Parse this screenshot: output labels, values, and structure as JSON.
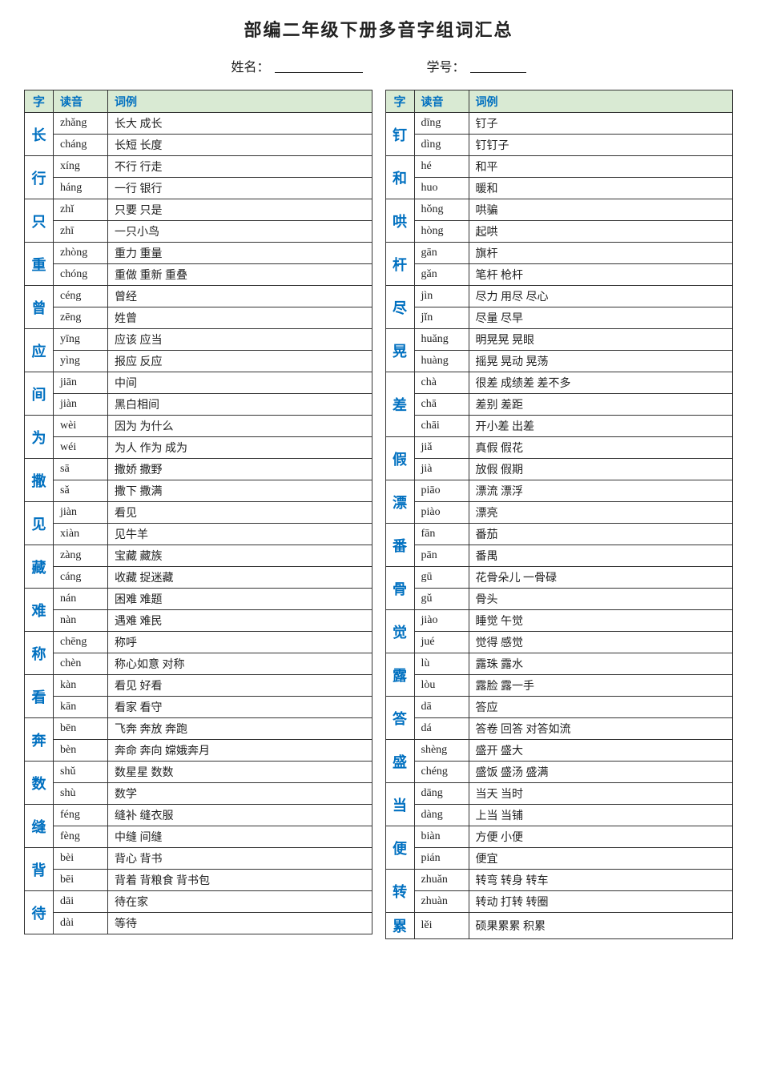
{
  "title": "部编二年级下册多音字组词汇总",
  "student": {
    "name_label": "姓名：",
    "id_label": "学号："
  },
  "left_table": {
    "headers": [
      "字",
      "读音",
      "词例"
    ],
    "rows": [
      {
        "char": "长",
        "pinyin": "zhǎng",
        "example": "长大   成长",
        "is_char_start": true
      },
      {
        "char": "",
        "pinyin": "cháng",
        "example": "长短   长度",
        "is_char_start": false
      },
      {
        "char": "行",
        "pinyin": "xíng",
        "example": "不行   行走",
        "is_char_start": true
      },
      {
        "char": "",
        "pinyin": "háng",
        "example": "一行   银行",
        "is_char_start": false
      },
      {
        "char": "只",
        "pinyin": "zhǐ",
        "example": "只要   只是",
        "is_char_start": true
      },
      {
        "char": "",
        "pinyin": "zhī",
        "example": "一只小鸟",
        "is_char_start": false
      },
      {
        "char": "重",
        "pinyin": "zhòng",
        "example": "重力   重量",
        "is_char_start": true
      },
      {
        "char": "",
        "pinyin": "chóng",
        "example": "重做   重新   重叠",
        "is_char_start": false
      },
      {
        "char": "曾",
        "pinyin": "céng",
        "example": "曾经",
        "is_char_start": true
      },
      {
        "char": "",
        "pinyin": "zēng",
        "example": "姓曾",
        "is_char_start": false
      },
      {
        "char": "应",
        "pinyin": "yīng",
        "example": "应该   应当",
        "is_char_start": true
      },
      {
        "char": "",
        "pinyin": "yìng",
        "example": "报应   反应",
        "is_char_start": false
      },
      {
        "char": "间",
        "pinyin": "jiān",
        "example": "中间",
        "is_char_start": true
      },
      {
        "char": "",
        "pinyin": "jiàn",
        "example": "黑白相间",
        "is_char_start": false
      },
      {
        "char": "为",
        "pinyin": "wèi",
        "example": "因为   为什么",
        "is_char_start": true
      },
      {
        "char": "",
        "pinyin": "wéi",
        "example": "为人   作为   成为",
        "is_char_start": false
      },
      {
        "char": "撒",
        "pinyin": "sā",
        "example": "撒娇   撒野",
        "is_char_start": true
      },
      {
        "char": "",
        "pinyin": "sǎ",
        "example": "撒下   撒满",
        "is_char_start": false
      },
      {
        "char": "见",
        "pinyin": "jiàn",
        "example": "看见",
        "is_char_start": true
      },
      {
        "char": "",
        "pinyin": "xiàn",
        "example": "见牛羊",
        "is_char_start": false
      },
      {
        "char": "藏",
        "pinyin": "zàng",
        "example": "宝藏   藏族",
        "is_char_start": true
      },
      {
        "char": "",
        "pinyin": "cáng",
        "example": "收藏   捉迷藏",
        "is_char_start": false
      },
      {
        "char": "难",
        "pinyin": "nán",
        "example": "困难   难题",
        "is_char_start": true
      },
      {
        "char": "",
        "pinyin": "nàn",
        "example": "遇难   难民",
        "is_char_start": false
      },
      {
        "char": "称",
        "pinyin": "chēng",
        "example": "称呼",
        "is_char_start": true
      },
      {
        "char": "",
        "pinyin": "chèn",
        "example": "称心如意   对称",
        "is_char_start": false
      },
      {
        "char": "看",
        "pinyin": "kàn",
        "example": "看见   好看",
        "is_char_start": true
      },
      {
        "char": "",
        "pinyin": "kān",
        "example": "看家   看守",
        "is_char_start": false
      },
      {
        "char": "奔",
        "pinyin": "bēn",
        "example": "飞奔   奔放   奔跑",
        "is_char_start": true
      },
      {
        "char": "",
        "pinyin": "bèn",
        "example": "奔命   奔向   嫦娥奔月",
        "is_char_start": false
      },
      {
        "char": "数",
        "pinyin": "shǔ",
        "example": "数星星   数数",
        "is_char_start": true
      },
      {
        "char": "",
        "pinyin": "shù",
        "example": "数学",
        "is_char_start": false
      },
      {
        "char": "缝",
        "pinyin": "féng",
        "example": "缝补   缝衣服",
        "is_char_start": true
      },
      {
        "char": "",
        "pinyin": "fèng",
        "example": "中缝   间缝",
        "is_char_start": false
      },
      {
        "char": "背",
        "pinyin": "bèi",
        "example": "背心   背书",
        "is_char_start": true
      },
      {
        "char": "",
        "pinyin": "bēi",
        "example": "背着   背粮食   背书包",
        "is_char_start": false
      },
      {
        "char": "待",
        "pinyin": "dāi",
        "example": "待在家",
        "is_char_start": true
      },
      {
        "char": "",
        "pinyin": "dài",
        "example": "等待",
        "is_char_start": false
      }
    ]
  },
  "right_table": {
    "headers": [
      "字",
      "读音",
      "词例"
    ],
    "rows": [
      {
        "char": "钉",
        "pinyin": "dīng",
        "example": "钉子",
        "is_char_start": true
      },
      {
        "char": "",
        "pinyin": "dìng",
        "example": "钉钉子",
        "is_char_start": false
      },
      {
        "char": "和",
        "pinyin": "hé",
        "example": "和平",
        "is_char_start": true
      },
      {
        "char": "",
        "pinyin": "huo",
        "example": "暖和",
        "is_char_start": false
      },
      {
        "char": "哄",
        "pinyin": "hǒng",
        "example": "哄骗",
        "is_char_start": true
      },
      {
        "char": "",
        "pinyin": "hòng",
        "example": "起哄",
        "is_char_start": false
      },
      {
        "char": "杆",
        "pinyin": "gān",
        "example": "旗杆",
        "is_char_start": true
      },
      {
        "char": "",
        "pinyin": "gǎn",
        "example": "笔杆   枪杆",
        "is_char_start": false
      },
      {
        "char": "尽",
        "pinyin": "jìn",
        "example": "尽力   用尽   尽心",
        "is_char_start": true
      },
      {
        "char": "",
        "pinyin": "jǐn",
        "example": "尽量   尽早",
        "is_char_start": false
      },
      {
        "char": "晃",
        "pinyin": "huǎng",
        "example": "明晃晃   晃眼",
        "is_char_start": true
      },
      {
        "char": "",
        "pinyin": "huàng",
        "example": "摇晃   晃动   晃荡",
        "is_char_start": false
      },
      {
        "char": "差",
        "pinyin": "chà",
        "example": "很差   成绩差   差不多",
        "is_char_start": true
      },
      {
        "char": "",
        "pinyin": "chā",
        "example": "差别   差距",
        "is_char_start": false
      },
      {
        "char": "",
        "pinyin": "chāi",
        "example": "开小差   出差",
        "is_char_start": false
      },
      {
        "char": "假",
        "pinyin": "jiǎ",
        "example": "真假   假花",
        "is_char_start": true
      },
      {
        "char": "",
        "pinyin": "jià",
        "example": "放假   假期",
        "is_char_start": false
      },
      {
        "char": "漂",
        "pinyin": "piāo",
        "example": "漂流   漂浮",
        "is_char_start": true
      },
      {
        "char": "",
        "pinyin": "piào",
        "example": "漂亮",
        "is_char_start": false
      },
      {
        "char": "番",
        "pinyin": "fān",
        "example": "番茄",
        "is_char_start": true
      },
      {
        "char": "",
        "pinyin": "pān",
        "example": "番禺",
        "is_char_start": false
      },
      {
        "char": "骨",
        "pinyin": "gū",
        "example": "花骨朵儿   一骨碌",
        "is_char_start": true
      },
      {
        "char": "",
        "pinyin": "gǔ",
        "example": "骨头",
        "is_char_start": false
      },
      {
        "char": "觉",
        "pinyin": "jiào",
        "example": "睡觉   午觉",
        "is_char_start": true
      },
      {
        "char": "",
        "pinyin": "jué",
        "example": "觉得   感觉",
        "is_char_start": false
      },
      {
        "char": "露",
        "pinyin": "lù",
        "example": "露珠   露水",
        "is_char_start": true
      },
      {
        "char": "",
        "pinyin": "lòu",
        "example": "露脸   露一手",
        "is_char_start": false
      },
      {
        "char": "答",
        "pinyin": "dā",
        "example": "答应",
        "is_char_start": true
      },
      {
        "char": "",
        "pinyin": "dá",
        "example": "答卷   回答   对答如流",
        "is_char_start": false
      },
      {
        "char": "盛",
        "pinyin": "shèng",
        "example": "盛开   盛大",
        "is_char_start": true
      },
      {
        "char": "",
        "pinyin": "chéng",
        "example": "盛饭   盛汤   盛满",
        "is_char_start": false
      },
      {
        "char": "当",
        "pinyin": "dāng",
        "example": "当天   当时",
        "is_char_start": true
      },
      {
        "char": "",
        "pinyin": "dàng",
        "example": "上当   当铺",
        "is_char_start": false
      },
      {
        "char": "便",
        "pinyin": "biàn",
        "example": "方便   小便",
        "is_char_start": true
      },
      {
        "char": "",
        "pinyin": "pián",
        "example": "便宜",
        "is_char_start": false
      },
      {
        "char": "转",
        "pinyin": "zhuǎn",
        "example": "转弯   转身   转车",
        "is_char_start": true
      },
      {
        "char": "",
        "pinyin": "zhuàn",
        "example": "转动   打转   转圈",
        "is_char_start": false
      },
      {
        "char": "累",
        "pinyin": "lěi",
        "example": "硕果累累   积累",
        "is_char_start": true
      }
    ]
  }
}
